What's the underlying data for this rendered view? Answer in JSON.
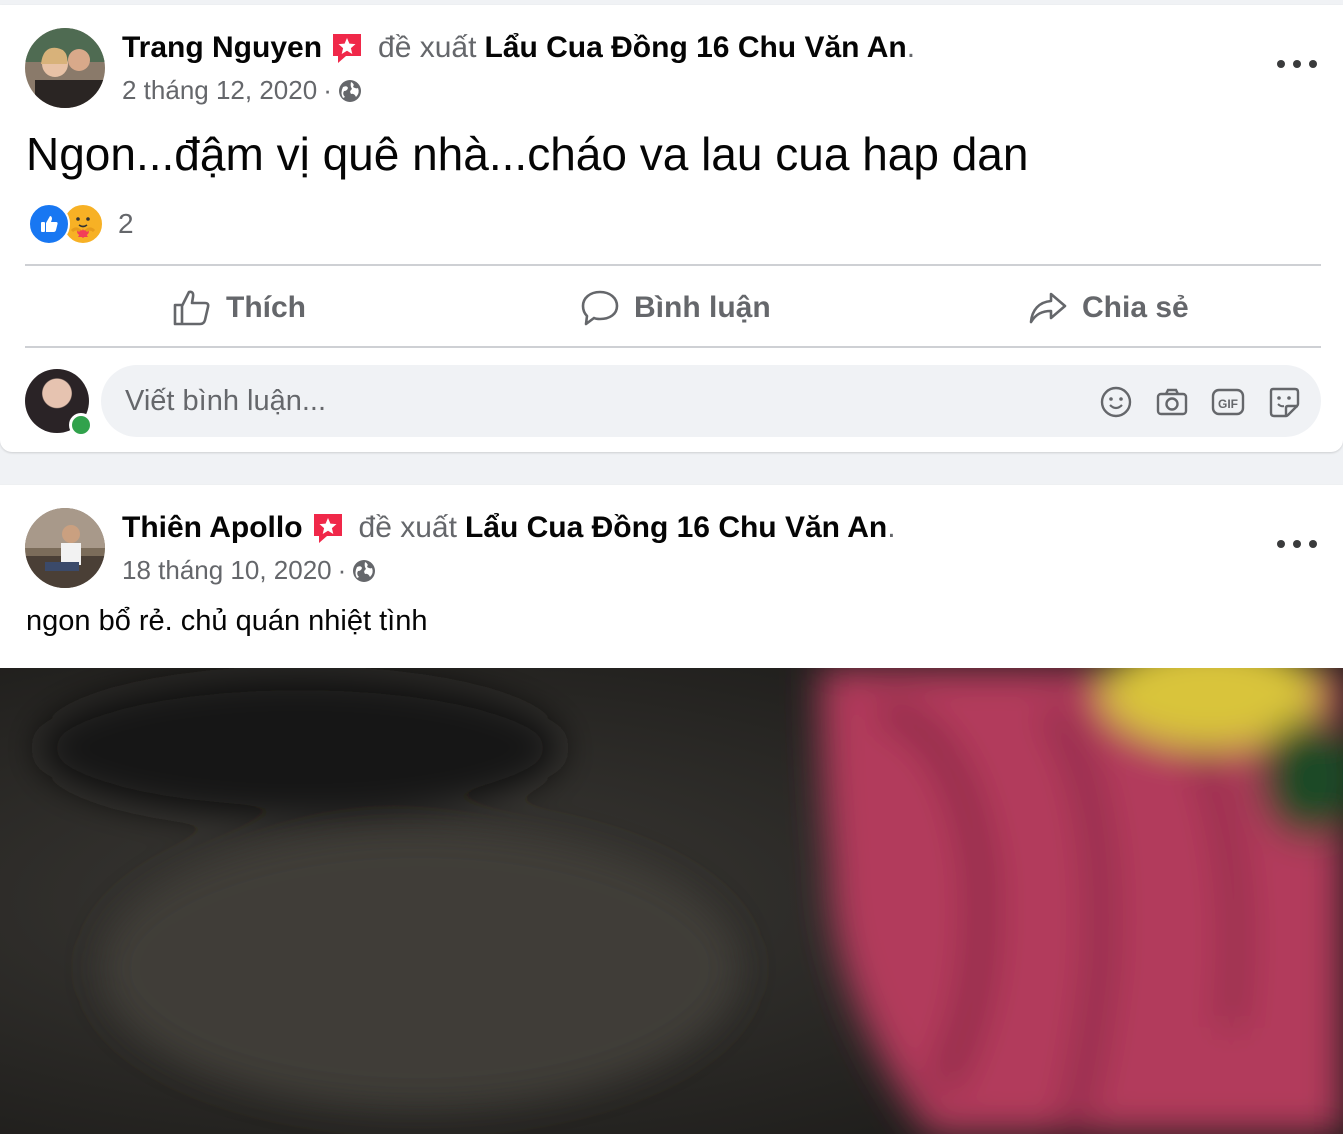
{
  "posts": [
    {
      "author": "Trang Nguyen",
      "verb": "đề xuất",
      "page": "Lẩu Cua Đồng 16 Chu Văn An",
      "period": ".",
      "date": "2 tháng 12, 2020",
      "separator": "·",
      "privacy_icon": "globe-icon",
      "text": "Ngon...đậm vị quê nhà...cháo va lau cua hap dan",
      "reaction_count": "2",
      "reactions": [
        "like",
        "care"
      ]
    },
    {
      "author": "Thiên Apollo",
      "verb": "đề xuất",
      "page": "Lẩu Cua Đồng 16 Chu Văn An",
      "period": ".",
      "date": "18 tháng 10, 2020",
      "separator": "·",
      "privacy_icon": "globe-icon",
      "text": "ngon bổ rẻ. chủ quán nhiệt tình"
    }
  ],
  "actions": {
    "like": "Thích",
    "comment": "Bình luận",
    "share": "Chia sẻ"
  },
  "comment": {
    "placeholder": "Viết bình luận...",
    "icons": [
      "emoji-icon",
      "camera-icon",
      "gif-icon",
      "sticker-icon"
    ]
  },
  "colors": {
    "brand_blue": "#1877f2",
    "recommend_badge": "#f02849",
    "online_green": "#31a24c",
    "secondary_text": "#65676b"
  }
}
